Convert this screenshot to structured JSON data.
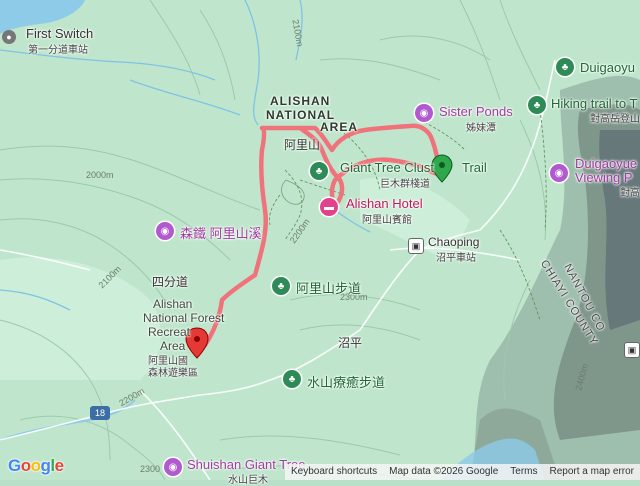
{
  "colors": {
    "terrain_light": "#c6ead2",
    "terrain_mid": "#a8d8b8",
    "terrain_dark": "#6a8078",
    "water": "#8ecbe8",
    "route": "#f26d77",
    "poi": "#b15ad0",
    "park": "#2e8b57",
    "hotel": "#e4418c"
  },
  "labels": {
    "first_switch": "First Switch",
    "first_switch_zh": "第一分道車站",
    "duigaoyue": "Duigaoyu",
    "hiking_trail": "Hiking trail to T",
    "hiking_trail_zh": "對高岳登山",
    "sister_ponds": "Sister Ponds",
    "sister_ponds_zh": "姊妹潭",
    "area_title_1": "ALISHAN",
    "area_title_2": "NATIONAL",
    "area_title_3": "AREA",
    "area_title_zh": "阿里山",
    "giant_tree": "Giant Tree Clust",
    "giant_tree_tail": "Trail",
    "giant_tree_zh": "巨木群棧道",
    "duigaoyue_view_1": "Duigaoyue",
    "duigaoyue_view_2": "Viewing P",
    "duigaoyue_view_zh": "對高",
    "alishan_hotel": "Alishan Hotel",
    "alishan_hotel_zh": "阿里山賓館",
    "forest_rail": "森鐵 阿里山溪",
    "chaoping": "Chaoping",
    "chaoping_zh": "沼平車站",
    "sifendao": "四分道",
    "alishan_trail_zh": "阿里山步道",
    "recreation_1": "Alishan",
    "recreation_2": "National Forest",
    "recreation_3": "Recreat",
    "recreation_4": "Area",
    "recreation_zh_1": "阿里山國",
    "recreation_zh_2": "森林遊樂區",
    "zhaoping": "沼平",
    "shuishan_trail_zh": "水山療癒步道",
    "shuishan_giant": "Shuishan Giant Tree",
    "shuishan_giant_zh": "水山巨木",
    "nantou_county": "NANTOU CO",
    "chiayi_county": "CHIAYI COUNTY",
    "road_18": "18",
    "elev_2100": "2100m",
    "elev_2000": "2000m",
    "elev_2200": "2200m",
    "elev_2300": "2300m",
    "elev_2300b": "2300",
    "elev_2400": "2400m"
  },
  "footer": {
    "keyboard": "Keyboard shortcuts",
    "map_data": "Map data ©2026 Google",
    "terms": "Terms",
    "report": "Report a map error"
  },
  "logo": "Google"
}
